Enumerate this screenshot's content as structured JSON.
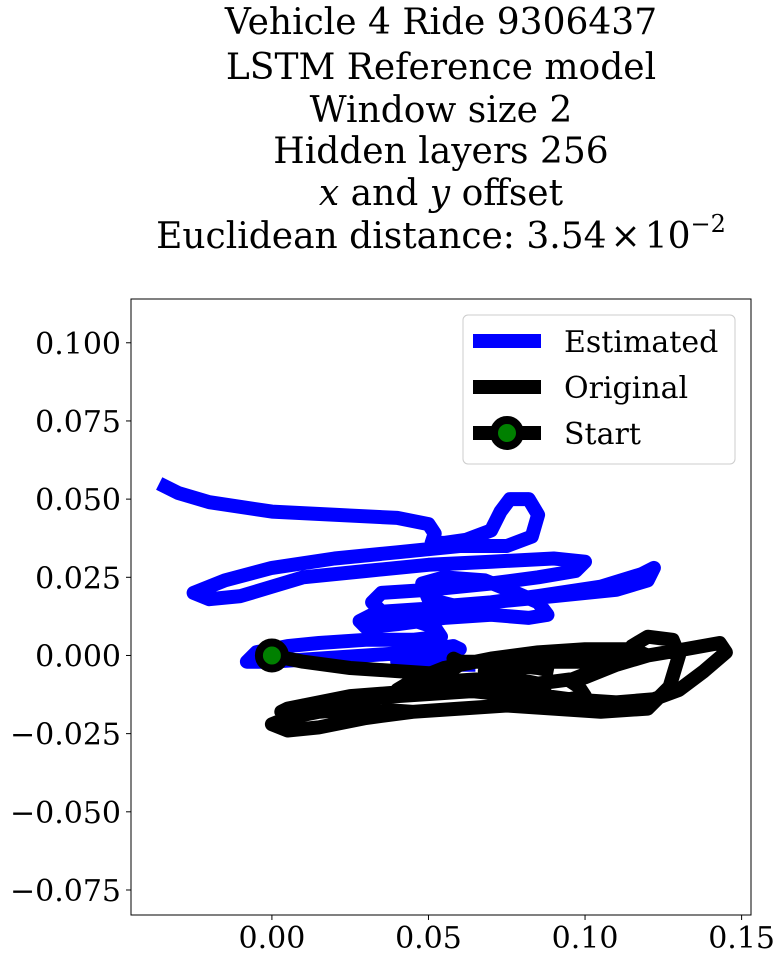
{
  "chart_data": {
    "type": "line",
    "title_lines": [
      "Vehicle 4 Ride 9306437",
      "LSTM Reference model",
      "Window size 2",
      "Hidden layers 256"
    ],
    "offset_line": {
      "x": "x",
      "mid": " and ",
      "y": "y",
      "end": " offset"
    },
    "distance_line": {
      "prefix": "Euclidean distance: ",
      "mantissa": "3.54",
      "times": "×",
      "base": "10",
      "exponent": "−2"
    },
    "xlim": [
      -0.045,
      0.153
    ],
    "ylim": [
      -0.083,
      0.114
    ],
    "xticks": [
      0.0,
      0.05,
      0.1,
      0.15
    ],
    "xtick_labels": [
      "0.00",
      "0.05",
      "0.10",
      "0.15"
    ],
    "yticks": [
      0.1,
      0.075,
      0.05,
      0.025,
      0.0,
      -0.025,
      -0.05,
      -0.075
    ],
    "ytick_labels": [
      "0.100",
      "0.075",
      "0.050",
      "0.025",
      "0.000",
      "−0.025",
      "−0.050",
      "−0.075"
    ],
    "legend_position": "upper right",
    "series": [
      {
        "name": "Estimated",
        "color": "#0000ff",
        "points": [
          [
            -0.036,
            0.055
          ],
          [
            -0.03,
            0.052
          ],
          [
            -0.02,
            0.049
          ],
          [
            0.0,
            0.046
          ],
          [
            0.02,
            0.045
          ],
          [
            0.04,
            0.044
          ],
          [
            0.05,
            0.042
          ],
          [
            0.052,
            0.039
          ],
          [
            0.051,
            0.036
          ],
          [
            0.055,
            0.036
          ],
          [
            0.062,
            0.037
          ],
          [
            0.07,
            0.04
          ],
          [
            0.073,
            0.046
          ],
          [
            0.076,
            0.05
          ],
          [
            0.082,
            0.05
          ],
          [
            0.085,
            0.045
          ],
          [
            0.083,
            0.038
          ],
          [
            0.075,
            0.035
          ],
          [
            0.06,
            0.035
          ],
          [
            0.04,
            0.033
          ],
          [
            0.02,
            0.031
          ],
          [
            0.0,
            0.028
          ],
          [
            -0.015,
            0.024
          ],
          [
            -0.025,
            0.02
          ],
          [
            -0.02,
            0.018
          ],
          [
            -0.01,
            0.019
          ],
          [
            0.0,
            0.022
          ],
          [
            0.01,
            0.025
          ],
          [
            0.03,
            0.027
          ],
          [
            0.05,
            0.029
          ],
          [
            0.07,
            0.03
          ],
          [
            0.09,
            0.031
          ],
          [
            0.1,
            0.03
          ],
          [
            0.097,
            0.027
          ],
          [
            0.085,
            0.025
          ],
          [
            0.07,
            0.023
          ],
          [
            0.05,
            0.021
          ],
          [
            0.035,
            0.02
          ],
          [
            0.032,
            0.017
          ],
          [
            0.035,
            0.014
          ],
          [
            0.05,
            0.015
          ],
          [
            0.07,
            0.017
          ],
          [
            0.09,
            0.019
          ],
          [
            0.11,
            0.021
          ],
          [
            0.12,
            0.024
          ],
          [
            0.122,
            0.028
          ],
          [
            0.118,
            0.026
          ],
          [
            0.105,
            0.022
          ],
          [
            0.085,
            0.019
          ],
          [
            0.07,
            0.017
          ],
          [
            0.058,
            0.016
          ],
          [
            0.05,
            0.018
          ],
          [
            0.048,
            0.023
          ],
          [
            0.055,
            0.025
          ],
          [
            0.068,
            0.024
          ],
          [
            0.078,
            0.02
          ],
          [
            0.085,
            0.017
          ],
          [
            0.088,
            0.013
          ],
          [
            0.082,
            0.012
          ],
          [
            0.07,
            0.013
          ],
          [
            0.055,
            0.012
          ],
          [
            0.04,
            0.01
          ],
          [
            0.03,
            0.009
          ],
          [
            0.028,
            0.011
          ],
          [
            0.032,
            0.013
          ],
          [
            0.04,
            0.013
          ],
          [
            0.052,
            0.009
          ],
          [
            0.054,
            0.006
          ],
          [
            0.045,
            0.005
          ],
          [
            0.03,
            0.005
          ],
          [
            0.015,
            0.004
          ],
          [
            0.005,
            0.003
          ],
          [
            -0.005,
            0.001
          ],
          [
            -0.008,
            -0.002
          ],
          [
            0.0,
            -0.002
          ],
          [
            0.015,
            -0.001
          ],
          [
            0.03,
            0.0
          ],
          [
            0.045,
            0.001
          ],
          [
            0.058,
            0.003
          ],
          [
            0.06,
            0.002
          ],
          [
            0.05,
            0.0
          ],
          [
            0.04,
            -0.002
          ],
          [
            0.05,
            -0.003
          ],
          [
            0.065,
            -0.003
          ]
        ]
      },
      {
        "name": "Original",
        "color": "#000000",
        "points": [
          [
            0.0,
            0.0
          ],
          [
            0.01,
            -0.002
          ],
          [
            0.025,
            -0.004
          ],
          [
            0.04,
            -0.005
          ],
          [
            0.055,
            -0.006
          ],
          [
            0.06,
            -0.003
          ],
          [
            0.058,
            -0.001
          ],
          [
            0.06,
            -0.002
          ],
          [
            0.08,
            -0.002
          ],
          [
            0.1,
            -0.002
          ],
          [
            0.115,
            -0.001
          ],
          [
            0.12,
            0.0
          ],
          [
            0.115,
            0.002
          ],
          [
            0.1,
            0.002
          ],
          [
            0.085,
            0.001
          ],
          [
            0.07,
            -0.001
          ],
          [
            0.055,
            -0.004
          ],
          [
            0.045,
            -0.008
          ],
          [
            0.04,
            -0.011
          ],
          [
            0.042,
            -0.012
          ],
          [
            0.05,
            -0.01
          ],
          [
            0.06,
            -0.008
          ],
          [
            0.075,
            -0.007
          ],
          [
            0.085,
            -0.009
          ],
          [
            0.088,
            -0.013
          ],
          [
            0.08,
            -0.014
          ],
          [
            0.07,
            -0.012
          ],
          [
            0.06,
            -0.011
          ],
          [
            0.05,
            -0.012
          ],
          [
            0.038,
            -0.012
          ],
          [
            0.025,
            -0.013
          ],
          [
            0.015,
            -0.015
          ],
          [
            0.005,
            -0.017
          ],
          [
            0.003,
            -0.018
          ],
          [
            0.01,
            -0.016
          ],
          [
            0.025,
            -0.014
          ],
          [
            0.04,
            -0.013
          ],
          [
            0.055,
            -0.012
          ],
          [
            0.07,
            -0.011
          ],
          [
            0.085,
            -0.009
          ],
          [
            0.1,
            -0.007
          ],
          [
            0.11,
            -0.003
          ],
          [
            0.115,
            0.003
          ],
          [
            0.12,
            0.006
          ],
          [
            0.128,
            0.005
          ],
          [
            0.13,
            0.0
          ],
          [
            0.127,
            -0.01
          ],
          [
            0.12,
            -0.017
          ],
          [
            0.105,
            -0.018
          ],
          [
            0.09,
            -0.017
          ],
          [
            0.075,
            -0.016
          ],
          [
            0.06,
            -0.017
          ],
          [
            0.045,
            -0.018
          ],
          [
            0.03,
            -0.017
          ],
          [
            0.015,
            -0.018
          ],
          [
            0.005,
            -0.02
          ],
          [
            0.0,
            -0.022
          ],
          [
            0.005,
            -0.024
          ],
          [
            0.015,
            -0.023
          ],
          [
            0.03,
            -0.02
          ],
          [
            0.045,
            -0.018
          ],
          [
            0.06,
            -0.017
          ],
          [
            0.075,
            -0.016
          ],
          [
            0.09,
            -0.015
          ],
          [
            0.1,
            -0.013
          ],
          [
            0.098,
            -0.01
          ],
          [
            0.095,
            -0.008
          ],
          [
            0.1,
            -0.006
          ],
          [
            0.11,
            -0.003
          ],
          [
            0.12,
            0.0
          ],
          [
            0.132,
            0.002
          ],
          [
            0.143,
            0.004
          ],
          [
            0.145,
            0.001
          ],
          [
            0.138,
            -0.005
          ],
          [
            0.13,
            -0.011
          ],
          [
            0.122,
            -0.014
          ],
          [
            0.11,
            -0.015
          ],
          [
            0.095,
            -0.014
          ],
          [
            0.08,
            -0.012
          ],
          [
            0.07,
            -0.009
          ],
          [
            0.068,
            -0.005
          ],
          [
            0.075,
            -0.003
          ],
          [
            0.085,
            -0.004
          ],
          [
            0.09,
            -0.005
          ]
        ]
      }
    ],
    "start": {
      "name": "Start",
      "x": 0.0,
      "y": 0.0,
      "marker_edge": "#000000",
      "marker_face": "#008000"
    }
  }
}
